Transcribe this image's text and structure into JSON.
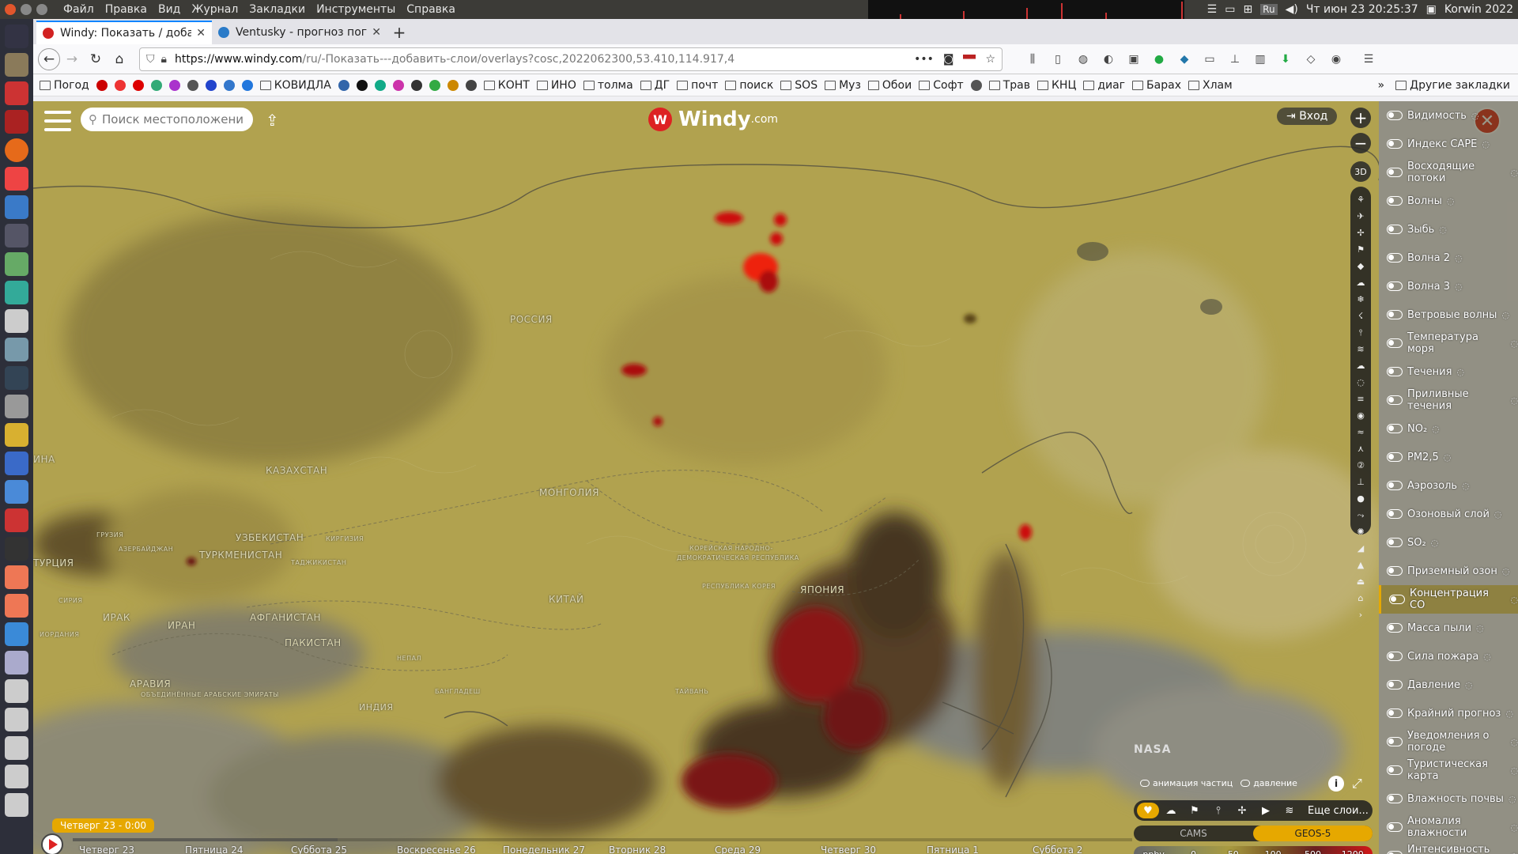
{
  "system": {
    "menu": [
      "Файл",
      "Правка",
      "Вид",
      "Журнал",
      "Закладки",
      "Инструменты",
      "Справка"
    ],
    "tray_lang": "Ru",
    "clock": "Чт июн 23 20:25:37",
    "user": "Korwin 2022"
  },
  "tabs": [
    {
      "title": "Windy: Показать / доба",
      "active": true,
      "favicon_color": "#d22222"
    },
    {
      "title": "Ventusky - прогноз пого",
      "active": false,
      "favicon_color": "#2a7bc8"
    }
  ],
  "nav": {
    "url_dark": "https://www.windy.com",
    "url_light": "/ru/-Показать---добавить-слои/overlays?cosc,2022062300,53.410,114.917,4"
  },
  "bookmarks": {
    "items": [
      {
        "label": "Погод",
        "folder": true
      },
      {
        "label": "",
        "folder": false,
        "color": "#c00"
      },
      {
        "label": "",
        "folder": false,
        "color": "#e33"
      },
      {
        "label": "",
        "folder": false,
        "color": "#d00"
      },
      {
        "label": "",
        "folder": false,
        "color": "#3a7"
      },
      {
        "label": "",
        "folder": false,
        "color": "#a3c"
      },
      {
        "label": "",
        "folder": false,
        "color": "#555"
      },
      {
        "label": "",
        "folder": false,
        "color": "#24c"
      },
      {
        "label": "",
        "folder": false,
        "color": "#37c"
      },
      {
        "label": "",
        "folder": false,
        "color": "#27d"
      },
      {
        "label": "КОВИДЛА",
        "folder": true
      },
      {
        "label": "",
        "folder": false,
        "color": "#36a"
      },
      {
        "label": "",
        "folder": false,
        "color": "#111"
      },
      {
        "label": "",
        "folder": false,
        "color": "#1a8"
      },
      {
        "label": "",
        "folder": false,
        "color": "#c3a"
      },
      {
        "label": "",
        "folder": false,
        "color": "#333"
      },
      {
        "label": "",
        "folder": false,
        "color": "#3a4"
      },
      {
        "label": "",
        "folder": false,
        "color": "#c80"
      },
      {
        "label": "",
        "folder": false,
        "color": "#444"
      },
      {
        "label": "КОНТ",
        "folder": true
      },
      {
        "label": "ИНО",
        "folder": true
      },
      {
        "label": "толма",
        "folder": true
      },
      {
        "label": "ДГ",
        "folder": true
      },
      {
        "label": "почт",
        "folder": true
      },
      {
        "label": "поиск",
        "folder": true
      },
      {
        "label": "SOS",
        "folder": true
      },
      {
        "label": "Муз",
        "folder": true
      },
      {
        "label": "Обои",
        "folder": true
      },
      {
        "label": "Софт",
        "folder": true
      },
      {
        "label": "",
        "folder": false,
        "color": "#555"
      },
      {
        "label": "Трав",
        "folder": true
      },
      {
        "label": "КНЦ",
        "folder": true
      },
      {
        "label": "диаг",
        "folder": true
      },
      {
        "label": "Барах",
        "folder": true
      },
      {
        "label": "Хлам",
        "folder": true
      }
    ],
    "other": "Другие закладки"
  },
  "windy": {
    "search_placeholder": "Поиск местоположения",
    "logo": "Windy",
    "logo_suffix": ".com",
    "login": "Вход",
    "zoom_in": "+",
    "zoom_out": "−",
    "view_3d": "3D",
    "nasa": "NASA",
    "particles_label": "анимация частиц",
    "pressure_label": "давление",
    "more_layers": "Еще слои...",
    "models": [
      {
        "label": "CAMS",
        "on": false
      },
      {
        "label": "GEOS-5",
        "on": true
      }
    ],
    "legend_unit": "ppbv",
    "legend_values": [
      "0",
      "50",
      "100",
      "500",
      "1200"
    ],
    "current_time": "Четверг 23 - 0:00",
    "progress_fraction": 0.25,
    "days": [
      {
        "label": "Четверг 23"
      },
      {
        "label": "Пятница 24"
      },
      {
        "label": "Суббота 25"
      },
      {
        "label": "Воскресенье 26"
      },
      {
        "label": "Понедельник 27"
      },
      {
        "label": "Вторник 28"
      },
      {
        "label": "Среда 29"
      },
      {
        "label": "Четверг 30"
      },
      {
        "label": "Пятница 1"
      },
      {
        "label": "Суббота 2"
      }
    ],
    "layers": [
      {
        "label": "Видимость",
        "icon": "eye-icon",
        "selected": false
      },
      {
        "label": "Индекс CAPE",
        "icon": "cloud-icon",
        "selected": false
      },
      {
        "label": "Восходящие потоки",
        "icon": "updraft-icon",
        "selected": false
      },
      {
        "label": "Волны",
        "icon": "waves-icon",
        "selected": false
      },
      {
        "label": "Зыбь",
        "icon": "swell-icon",
        "selected": false
      },
      {
        "label": "Волна 2",
        "icon": "wave2-icon",
        "selected": false
      },
      {
        "label": "Волна 3",
        "icon": "wave3-icon",
        "selected": false
      },
      {
        "label": "Ветровые волны",
        "icon": "windwave-icon",
        "selected": false
      },
      {
        "label": "Температура моря",
        "icon": "thermometer-icon",
        "selected": false
      },
      {
        "label": "Течения",
        "icon": "current-icon",
        "selected": false
      },
      {
        "label": "Приливные течения",
        "icon": "tide-icon",
        "selected": false
      },
      {
        "label": "NO₂",
        "icon": "factory-icon",
        "selected": false
      },
      {
        "label": "PM2,5",
        "icon": "dust-icon",
        "selected": false
      },
      {
        "label": "Аэрозоль",
        "icon": "aerosol-icon",
        "selected": false
      },
      {
        "label": "Озоновый слой",
        "icon": "sun-icon",
        "selected": false
      },
      {
        "label": "SO₂",
        "icon": "volcano-icon",
        "selected": false
      },
      {
        "label": "Приземный озон",
        "icon": "ozone-icon",
        "selected": false
      },
      {
        "label": "Концентрация CO",
        "icon": "co-icon",
        "selected": true
      },
      {
        "label": "Масса пыли",
        "icon": "dust-mass-icon",
        "selected": false
      },
      {
        "label": "Сила пожара",
        "icon": "fire-icon",
        "selected": false
      },
      {
        "label": "Давление",
        "icon": "pressure-icon",
        "selected": false
      },
      {
        "label": "Крайний прогноз",
        "icon": "warning-icon",
        "selected": false
      },
      {
        "label": "Уведомления о погоде",
        "icon": "bell-icon",
        "selected": false
      },
      {
        "label": "Туристическая карта",
        "icon": "map-icon",
        "selected": false
      },
      {
        "label": "Влажность почвы",
        "icon": "soil-icon",
        "selected": false
      },
      {
        "label": "Аномалия влажности",
        "icon": "anomaly-icon",
        "selected": false
      },
      {
        "label": "Интенсивность засух",
        "icon": "drought-icon",
        "selected": false
      }
    ],
    "map_labels": [
      {
        "text": "РОССИЯ",
        "small": false
      },
      {
        "text": "КАЗАХСТАН",
        "small": false
      },
      {
        "text": "МОНГОЛИЯ",
        "small": false
      },
      {
        "text": "УЗБЕКИСТАН",
        "small": false
      },
      {
        "text": "ТУРКМЕНИСТАН",
        "small": false
      },
      {
        "text": "ТУРЦИЯ",
        "small": false
      },
      {
        "text": "КИТАЙ",
        "small": false
      },
      {
        "text": "ИРАК",
        "small": false
      },
      {
        "text": "ИРАН",
        "small": false
      },
      {
        "text": "АФГАНИСТАН",
        "small": false
      },
      {
        "text": "ПАКИСТАН",
        "small": false
      },
      {
        "text": "ЯПОНИЯ",
        "small": false
      },
      {
        "text": "АРАВИЯ",
        "small": false
      },
      {
        "text": "ИНА",
        "small": false
      },
      {
        "text": "КИРГИЗИЯ",
        "small": true
      },
      {
        "text": "ТАДЖИКИСТАН",
        "small": true
      },
      {
        "text": "ГРУЗИЯ",
        "small": true
      },
      {
        "text": "АЗЕРБАЙДЖАН",
        "small": true
      },
      {
        "text": "СИРИЯ",
        "small": true
      },
      {
        "text": "ИОРДАНИЯ",
        "small": true
      },
      {
        "text": "НЕПАЛ",
        "small": true
      },
      {
        "text": "БАНГЛАДЕШ",
        "small": true
      },
      {
        "text": "ИНДИЯ",
        "small": false
      },
      {
        "text": "ТАЙВАНЬ",
        "small": true
      },
      {
        "text": "КОРЕЙСКАЯ НАРОДНО-",
        "small": true
      },
      {
        "text": "ДЕМОКРАТИЧЕСКАЯ РЕСПУБЛИКА",
        "small": true
      },
      {
        "text": "РЕСПУБЛИКА КОРЕЯ",
        "small": true
      },
      {
        "text": "ОБЪЕДИНЁННЫЕ АРАБСКИЕ ЭМИРАТЫ",
        "small": true
      }
    ]
  }
}
